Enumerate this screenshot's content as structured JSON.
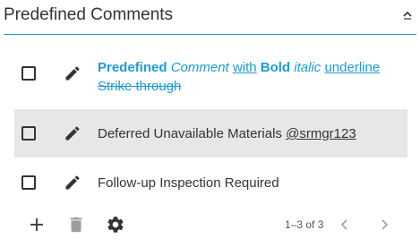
{
  "header": {
    "title": "Predefined Comments"
  },
  "comments": [
    {
      "parts": {
        "p1": "Predefined",
        "p2": "Comment",
        "p3": "with",
        "p4": "Bold",
        "p5": "italic",
        "p6": "underline",
        "p7": "Strike through"
      }
    },
    {
      "text": "Deferred Unavailable Materials ",
      "mention": "@srmgr123",
      "selected": true
    },
    {
      "text": "Follow-up Inspection Required"
    }
  ],
  "footer": {
    "pager_text": "1–3 of 3"
  },
  "icons": {
    "collapse": "chevron-up-icon",
    "edit": "pencil-icon",
    "add": "plus-icon",
    "delete": "trash-icon",
    "settings": "gear-icon",
    "prev": "chevron-left-icon",
    "next": "chevron-right-icon"
  },
  "colors": {
    "accent": "#1e9bd7",
    "selected_row": "#e7e7e7",
    "icon": "#333333",
    "disabled_icon": "#9e9e9e"
  }
}
